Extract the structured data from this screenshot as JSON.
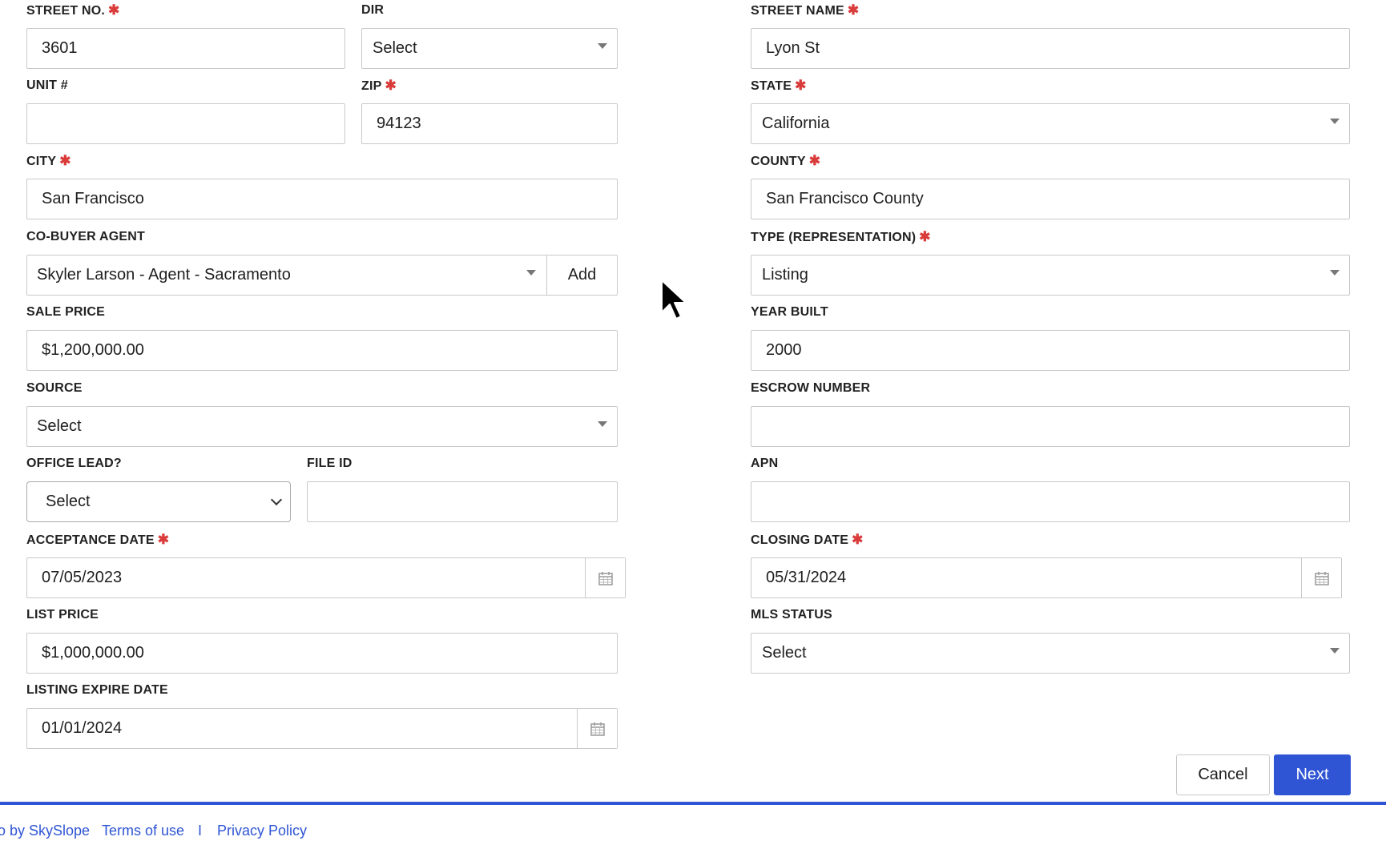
{
  "form": {
    "street_no": {
      "label": "STREET NO.",
      "value": "3601"
    },
    "dir": {
      "label": "DIR",
      "value": "Select"
    },
    "street_name": {
      "label": "STREET NAME",
      "value": "Lyon St"
    },
    "unit": {
      "label": "UNIT #",
      "value": ""
    },
    "zip": {
      "label": "ZIP",
      "value": "94123"
    },
    "state": {
      "label": "STATE",
      "value": "California"
    },
    "city": {
      "label": "CITY",
      "value": "San Francisco"
    },
    "county": {
      "label": "COUNTY",
      "value": "San Francisco County"
    },
    "co_buyer_agent": {
      "label": "CO-BUYER AGENT",
      "value": "Skyler Larson - Agent - Sacramento",
      "add_label": "Add"
    },
    "type_representation": {
      "label": "TYPE (REPRESENTATION)",
      "value": "Listing"
    },
    "sale_price": {
      "label": "SALE PRICE",
      "value": "$1,200,000.00"
    },
    "year_built": {
      "label": "YEAR BUILT",
      "value": "2000"
    },
    "source": {
      "label": "SOURCE",
      "value": "Select"
    },
    "escrow_number": {
      "label": "ESCROW NUMBER",
      "value": ""
    },
    "office_lead": {
      "label": "OFFICE LEAD?",
      "value": "Select"
    },
    "file_id": {
      "label": "FILE ID",
      "value": ""
    },
    "apn": {
      "label": "APN",
      "value": ""
    },
    "acceptance_date": {
      "label": "ACCEPTANCE DATE",
      "value": "07/05/2023"
    },
    "closing_date": {
      "label": "CLOSING DATE",
      "value": "05/31/2024"
    },
    "list_price": {
      "label": "LIST PRICE",
      "value": "$1,000,000.00"
    },
    "mls_status": {
      "label": "MLS STATUS",
      "value": "Select"
    },
    "listing_expire_date": {
      "label": "LISTING EXPIRE DATE",
      "value": "01/01/2024"
    }
  },
  "required_marker": "✱",
  "actions": {
    "cancel": "Cancel",
    "next": "Next"
  },
  "footer": {
    "powered_by": "o by SkySlope",
    "terms": "Terms of use",
    "separator": "I",
    "privacy": "Privacy Policy"
  },
  "colors": {
    "primary": "#2f55d4",
    "required": "#d93b3b",
    "border": "#c9c9c9"
  }
}
